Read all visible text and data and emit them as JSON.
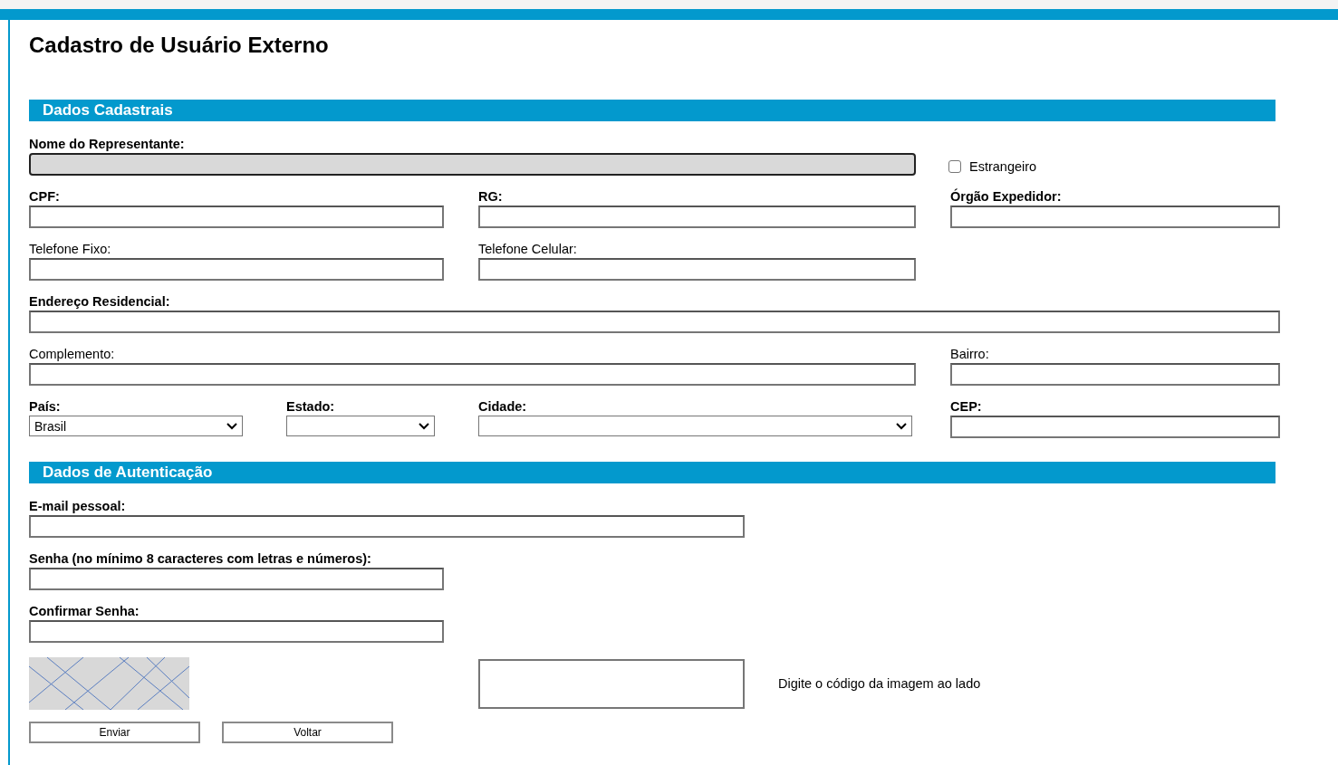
{
  "title": "Cadastro de Usuário Externo",
  "sections": [
    {
      "title": "Dados Cadastrais",
      "fields": [
        {
          "kind": "text",
          "label": "Nome do Representante:",
          "bold": true,
          "disabled": true
        },
        {
          "kind": "checkbox",
          "label": "Estrangeiro",
          "checked": false
        },
        {
          "kind": "text",
          "label": "CPF:",
          "bold": true,
          "disabled": false
        },
        {
          "kind": "text",
          "label": "RG:",
          "bold": true,
          "disabled": false
        },
        {
          "kind": "text",
          "label": "Órgão Expedidor:",
          "bold": true,
          "disabled": false
        },
        {
          "kind": "text",
          "label": "Telefone Fixo:",
          "bold": false,
          "disabled": false
        },
        {
          "kind": "text",
          "label": "Telefone Celular:",
          "bold": false,
          "disabled": false
        },
        {
          "kind": "text",
          "label": "Endereço Residencial:",
          "bold": true,
          "disabled": false
        },
        {
          "kind": "text",
          "label": "Complemento:",
          "bold": false,
          "disabled": false
        },
        {
          "kind": "text",
          "label": "Bairro:",
          "bold": false,
          "disabled": false
        },
        {
          "kind": "select",
          "label": "País:",
          "bold": true,
          "value": "Brasil"
        },
        {
          "kind": "select",
          "label": "Estado:",
          "bold": true
        },
        {
          "kind": "select",
          "label": "Cidade:",
          "bold": true
        },
        {
          "kind": "text",
          "label": "CEP:",
          "bold": true,
          "disabled": false
        }
      ]
    },
    {
      "title": "Dados de Autenticação",
      "fields": [
        {
          "kind": "text",
          "label": "E-mail pessoal:",
          "bold": true,
          "disabled": false
        },
        {
          "kind": "text",
          "label": "Senha (no mínimo 8 caracteres com letras e números):",
          "bold": true,
          "disabled": false
        },
        {
          "kind": "text",
          "label": "Confirmar Senha:",
          "bold": true,
          "disabled": false
        }
      ]
    }
  ],
  "captcha": {
    "hint": "Digite o código da imagem ao lado"
  },
  "buttons": [
    "Enviar",
    "Voltar"
  ]
}
